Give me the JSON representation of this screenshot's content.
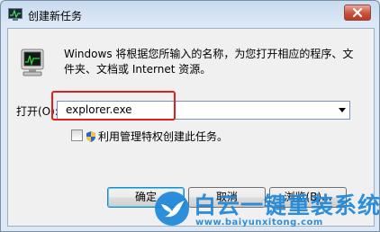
{
  "window": {
    "title": "创建新任务",
    "close_label": "✕"
  },
  "dialog": {
    "description": "Windows 将根据您所输入的名称，为您打开相应的程序、文件夹、文档或 Internet 资源。",
    "open_label": "打开(O):",
    "open_value": "explorer.exe",
    "admin_checkbox_label": "利用管理特权创建此任务。",
    "admin_checked": false
  },
  "buttons": {
    "ok": "确定",
    "cancel": "取消",
    "browse": "浏览(B)..."
  },
  "watermark": {
    "brand": "白云一键重装系统",
    "url": "www.baiyunxitong.com"
  },
  "colors": {
    "highlight": "#e02020",
    "watermark": "#1d86d9"
  }
}
